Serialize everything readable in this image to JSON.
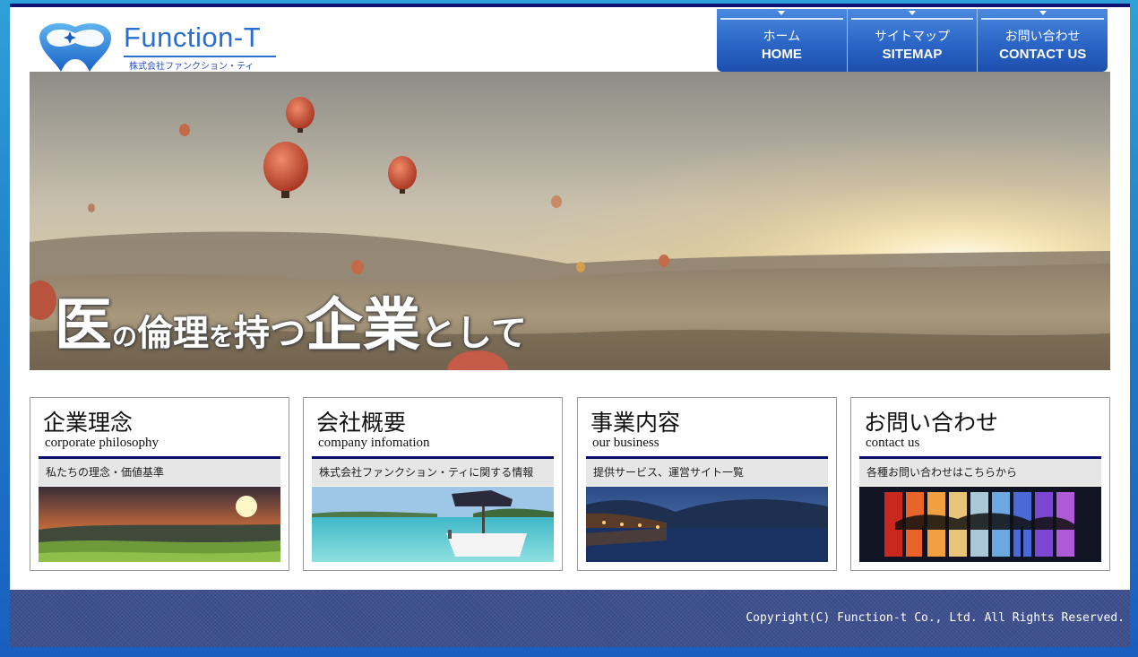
{
  "logo": {
    "name": "Function-T",
    "sub": "株式会社ファンクション・ティ"
  },
  "nav": [
    {
      "jp": "ホーム",
      "en": "HOME"
    },
    {
      "jp": "サイトマップ",
      "en": "SITEMAP"
    },
    {
      "jp": "お問い合わせ",
      "en": "CONTACT US"
    }
  ],
  "hero": {
    "tagline": {
      "c1": "医",
      "c2": "の",
      "c3": "倫理",
      "c4": "を",
      "c5": "持つ",
      "c6": "企業",
      "c7": "として"
    }
  },
  "cards": [
    {
      "title": "企業理念",
      "sub": "corporate philosophy",
      "desc": "私たちの理念・価値基準"
    },
    {
      "title": "会社概要",
      "sub": "company infomation",
      "desc": "株式会社ファンクション・ティに関する情報"
    },
    {
      "title": "事業内容",
      "sub": "our business",
      "desc": "提供サービス、運営サイト一覧"
    },
    {
      "title": "お問い合わせ",
      "sub": "contact us",
      "desc": "各種お問い合わせはこちらから"
    }
  ],
  "footer": {
    "copyright": "Copyright(C) Function-t Co., Ltd. All Rights Reserved."
  },
  "colors": {
    "accent": "#2a6fd0",
    "nav": "#2b66c6",
    "card_rule": "#0b0d6a",
    "footer": "#3e5090"
  }
}
